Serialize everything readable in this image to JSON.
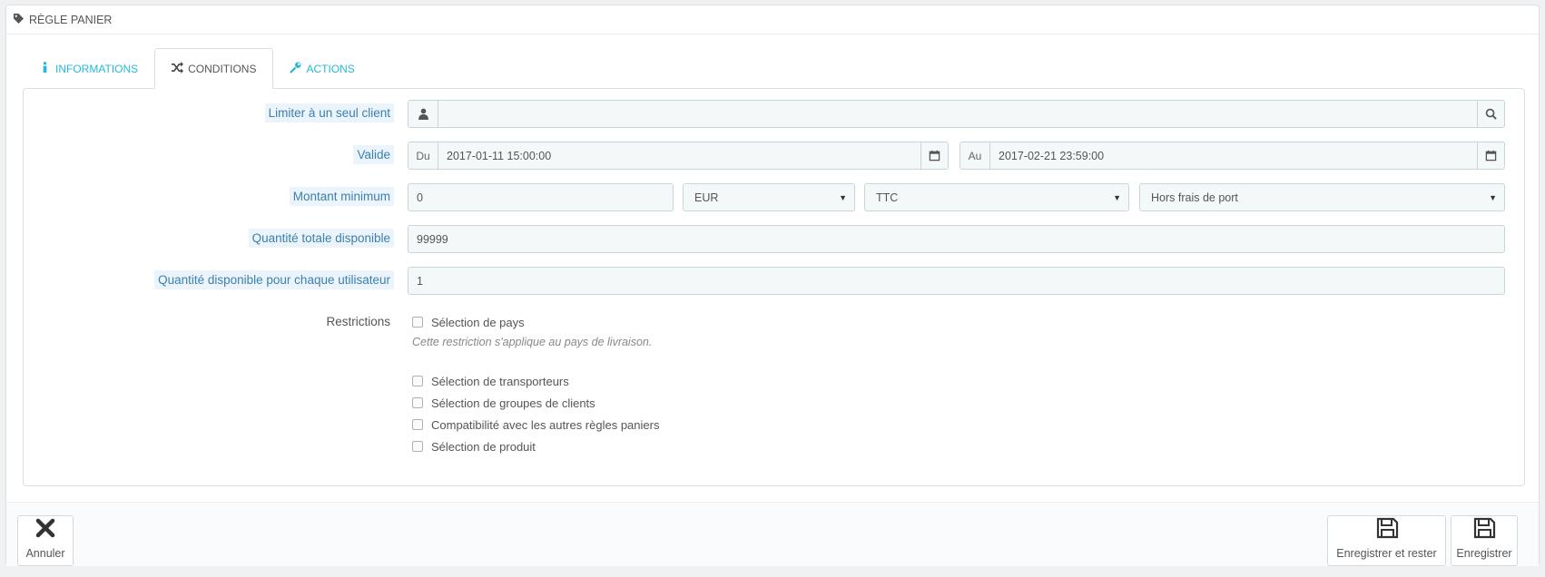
{
  "panel": {
    "title": "Règle panier"
  },
  "tabs": [
    {
      "label": "Informations",
      "icon": "info-icon",
      "active": false
    },
    {
      "label": "Conditions",
      "icon": "random-icon",
      "active": true
    },
    {
      "label": "Actions",
      "icon": "wrench-icon",
      "active": false
    }
  ],
  "form": {
    "customer": {
      "label": "Limiter à un seul client",
      "value": ""
    },
    "valid": {
      "label": "Valide",
      "from_prefix": "Du",
      "from_value": "2017-01-11 15:00:00",
      "to_prefix": "Au",
      "to_value": "2017-02-21 23:59:00"
    },
    "minimum": {
      "label": "Montant minimum",
      "value": "0",
      "currency": "EUR",
      "tax": "TTC",
      "shipping": "Hors frais de port"
    },
    "quantity": {
      "label": "Quantité totale disponible",
      "value": "99999"
    },
    "quantity_per_user": {
      "label": "Quantité disponible pour chaque utilisateur",
      "value": "1"
    },
    "restrictions": {
      "label": "Restrictions",
      "country": "Sélection de pays",
      "country_help": "Cette restriction s'applique au pays de livraison.",
      "carrier": "Sélection de transporteurs",
      "group": "Sélection de groupes de clients",
      "compatibility": "Compatibilité avec les autres règles paniers",
      "product": "Sélection de produit"
    }
  },
  "footer": {
    "cancel": "Annuler",
    "save_stay": "Enregistrer et rester",
    "save": "Enregistrer"
  },
  "colors": {
    "accent": "#25b9d7",
    "label_bg": "#eaf4fa",
    "label_text": "#3d7fae"
  }
}
